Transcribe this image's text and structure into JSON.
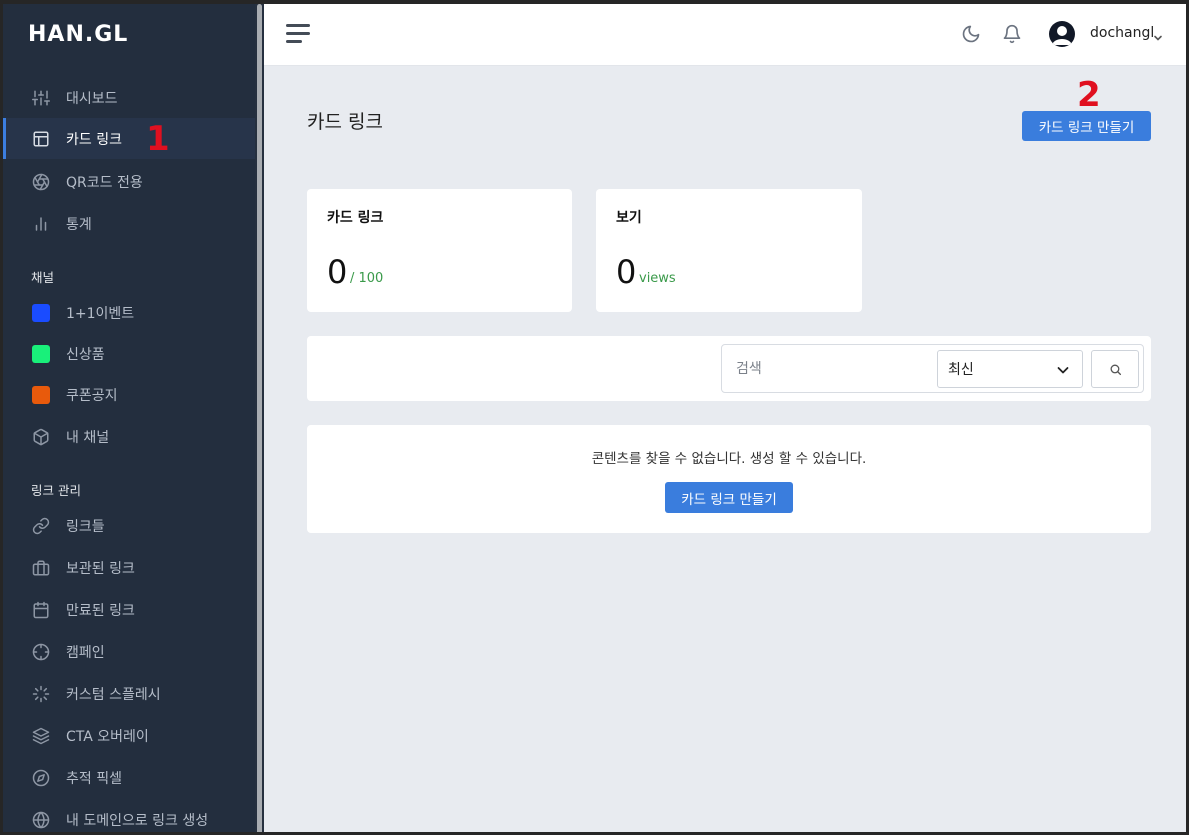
{
  "brand": {
    "logo": "HAN.GL"
  },
  "sidebar": {
    "main_items": [
      {
        "label": "대시보드",
        "icon": "sliders-icon"
      },
      {
        "label": "카드 링크",
        "icon": "layout-icon",
        "active": true
      },
      {
        "label": "QR코드 전용",
        "icon": "aperture-icon"
      },
      {
        "label": "통계",
        "icon": "bar-chart-icon"
      }
    ],
    "channels_title": "채널",
    "channels": [
      {
        "label": "1+1이벤트",
        "color": "#1a4cff"
      },
      {
        "label": "신상품",
        "color": "#19f07a"
      },
      {
        "label": "쿠폰공지",
        "color": "#e85a0c"
      },
      {
        "label": "내 채널",
        "icon": "box-icon"
      }
    ],
    "links_title": "링크 관리",
    "links": [
      {
        "label": "링크들",
        "icon": "link-icon"
      },
      {
        "label": "보관된 링크",
        "icon": "briefcase-icon"
      },
      {
        "label": "만료된 링크",
        "icon": "calendar-icon"
      },
      {
        "label": "캠페인",
        "icon": "crosshair-icon"
      },
      {
        "label": "커스텀 스플레시",
        "icon": "loader-icon"
      },
      {
        "label": "CTA 오버레이",
        "icon": "layers-icon"
      },
      {
        "label": "추적 픽셀",
        "icon": "compass-icon"
      },
      {
        "label": "내 도메인으로 링크 생성",
        "icon": "globe-icon"
      }
    ]
  },
  "annotations": {
    "one": "1",
    "two": "2"
  },
  "header": {
    "username": "dochangl"
  },
  "main": {
    "title": "카드 링크",
    "create_button": "카드 링크 만들기",
    "stats": {
      "links": {
        "title": "카드 링크",
        "value": "0",
        "sub": "/ 100"
      },
      "views": {
        "title": "보기",
        "value": "0",
        "sub": "views"
      }
    },
    "search": {
      "placeholder": "검색",
      "sort_value": "최신"
    },
    "empty": {
      "message": "콘텐츠를 찾을 수 없습니다. 생성 할 수 있습니다.",
      "button": "카드 링크 만들기"
    }
  }
}
